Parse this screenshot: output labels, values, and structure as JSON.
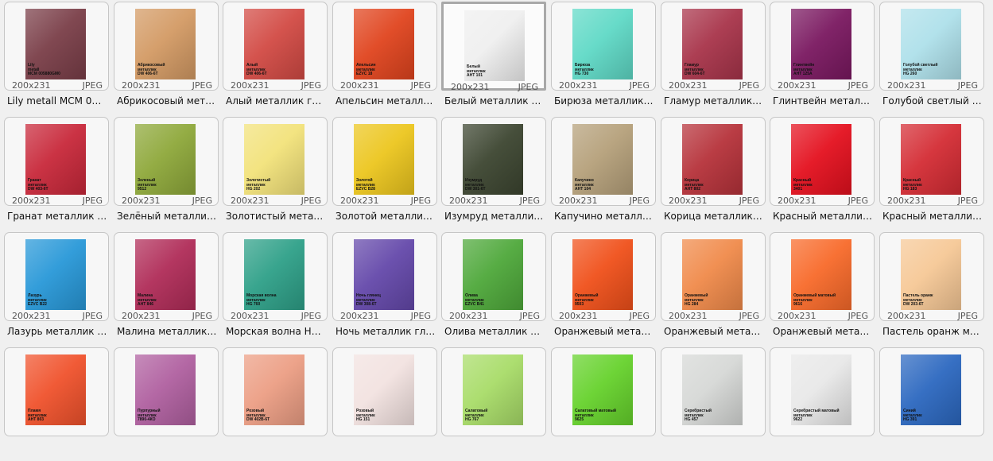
{
  "thumbnails": [
    {
      "caption": "Lily metall MCM 005...",
      "dims": "200x231",
      "format": "JPEG",
      "tag": [
        "Lily",
        "metall",
        "MCM 005880GM0"
      ],
      "color": "#7a3e48"
    },
    {
      "caption": "Абрикосовый метал...",
      "dims": "200x231",
      "format": "JPEG",
      "tag": [
        "Абрикосовый",
        "металлик",
        "DW 406-6T"
      ],
      "color": "#d39a64"
    },
    {
      "caption": "Алый металлик гля...",
      "dims": "200x231",
      "format": "JPEG",
      "tag": [
        "Алый",
        "металлик",
        "DW 406-6T"
      ],
      "color": "#d24a44"
    },
    {
      "caption": "Апельсин металлик...",
      "dims": "200x231",
      "format": "JPEG",
      "tag": [
        "Апельсин",
        "металлик",
        "EZVC 18"
      ],
      "color": "#e0441e"
    },
    {
      "caption": "Белый металлик А...",
      "dims": "200x231",
      "format": "JPEG",
      "tag": [
        "Белый",
        "металлик",
        "АНТ 101"
      ],
      "color": "#efefef",
      "selected": true
    },
    {
      "caption": "Бирюза металлик Н...",
      "dims": "200x231",
      "format": "JPEG",
      "tag": [
        "Бирюза",
        "металлик",
        "HG 730"
      ],
      "color": "#5fd9c6"
    },
    {
      "caption": "Гламур металлик г...",
      "dims": "200x231",
      "format": "JPEG",
      "tag": [
        "Гламур",
        "металлик",
        "DW 604-6T"
      ],
      "color": "#a8344a"
    },
    {
      "caption": "Глинтвейн металли...",
      "dims": "200x231",
      "format": "JPEG",
      "tag": [
        "Глинтвейн",
        "металлик",
        "АНТ 125А"
      ],
      "color": "#7a1860"
    },
    {
      "caption": "Голубой светлый м...",
      "dims": "200x231",
      "format": "JPEG",
      "tag": [
        "Голубой светлый",
        "металлик",
        "HG 260"
      ],
      "color": "#aee0ea"
    },
    {
      "caption": "Гранат металлик гл...",
      "dims": "200x231",
      "format": "JPEG",
      "tag": [
        "Гранат",
        "металлик",
        "DW 403-6T"
      ],
      "color": "#c8283a"
    },
    {
      "caption": "Зелёный металлик ...",
      "dims": "200x231",
      "format": "JPEG",
      "tag": [
        "Зеленый",
        "металлик",
        "9512"
      ],
      "color": "#8ea83a"
    },
    {
      "caption": "Золотистый металл...",
      "dims": "200x231",
      "format": "JPEG",
      "tag": [
        "Золотистый",
        "металлик",
        "HG 202"
      ],
      "color": "#f2e27a"
    },
    {
      "caption": "Золотой металлик ...",
      "dims": "200x231",
      "format": "JPEG",
      "tag": [
        "Золотой",
        "металлик",
        "EZVC B28"
      ],
      "color": "#ecc61e"
    },
    {
      "caption": "Изумруд металлик ...",
      "dims": "200x231",
      "format": "JPEG",
      "tag": [
        "Изумруд",
        "металлик",
        "DW 301-6T"
      ],
      "color": "#3c4530"
    },
    {
      "caption": "Капучино металлик...",
      "dims": "200x231",
      "format": "JPEG",
      "tag": [
        "Капучино",
        "металлик",
        "АНТ 104"
      ],
      "color": "#b5a07a"
    },
    {
      "caption": "Корица металлик А...",
      "dims": "200x231",
      "format": "JPEG",
      "tag": [
        "Корица",
        "металлик",
        "АНТ 802"
      ],
      "color": "#b6323a"
    },
    {
      "caption": "Красный металлик ...",
      "dims": "200x231",
      "format": "JPEG",
      "tag": [
        "Красный",
        "металлик",
        "3401"
      ],
      "color": "#e4101e"
    },
    {
      "caption": "Красный металлик ...",
      "dims": "200x231",
      "format": "JPEG",
      "tag": [
        "Красный",
        "металлик",
        "HG 183"
      ],
      "color": "#d42c34"
    },
    {
      "caption": "Лазурь металлик гл...",
      "dims": "200x231",
      "format": "JPEG",
      "tag": [
        "Лазурь",
        "металлик",
        "EZVC B22"
      ],
      "color": "#2898d8"
    },
    {
      "caption": "Малина металлик гл...",
      "dims": "200x231",
      "format": "JPEG",
      "tag": [
        "Малина",
        "металлик",
        "АНТ 846"
      ],
      "color": "#b02c58"
    },
    {
      "caption": "Морская волна HG ...",
      "dims": "200x231",
      "format": "JPEG",
      "tag": [
        "Морская волна",
        "металлик",
        "HG 760"
      ],
      "color": "#2ea088"
    },
    {
      "caption": "Ночь металлик гля...",
      "dims": "200x231",
      "format": "JPEG",
      "tag": [
        "Ночь глянец",
        "металлик",
        "DW 308-6T"
      ],
      "color": "#6448aa"
    },
    {
      "caption": "Олива металлик гл...",
      "dims": "200x231",
      "format": "JPEG",
      "tag": [
        "Олива",
        "металлик",
        "EZVC B41"
      ],
      "color": "#4ea83a"
    },
    {
      "caption": "Оранжевый металл...",
      "dims": "200x231",
      "format": "JPEG",
      "tag": [
        "Оранжевый",
        "металлик",
        "9503"
      ],
      "color": "#f0501a"
    },
    {
      "caption": "Оранжевый металл...",
      "dims": "200x231",
      "format": "JPEG",
      "tag": [
        "Оранжевый",
        "металлик",
        "HG 284"
      ],
      "color": "#f08a4a"
    },
    {
      "caption": "Оранжевый металл...",
      "dims": "200x231",
      "format": "JPEG",
      "tag": [
        "Оранжевый матовый",
        "металлик",
        "9616"
      ],
      "color": "#f86a2a"
    },
    {
      "caption": "Пастель оранж мет...",
      "dims": "200x231",
      "format": "JPEG",
      "tag": [
        "Пастель оранж",
        "металлик",
        "DW 203-6T"
      ],
      "color": "#f6c896"
    },
    {
      "caption": "",
      "dims": "",
      "format": "",
      "tag": [
        "Пламя",
        "металлик",
        "АНТ 803"
      ],
      "color": "#f0522c"
    },
    {
      "caption": "",
      "dims": "",
      "format": "",
      "tag": [
        "Пурпурный",
        "металлик",
        "7890-4КО"
      ],
      "color": "#b060a0"
    },
    {
      "caption": "",
      "dims": "",
      "format": "",
      "tag": [
        "Розовый",
        "металлик",
        "DW 402B-6T"
      ],
      "color": "#ec9e84"
    },
    {
      "caption": "",
      "dims": "",
      "format": "",
      "tag": [
        "Розовый",
        "металлик",
        "HG 151"
      ],
      "color": "#f2e2e0"
    },
    {
      "caption": "",
      "dims": "",
      "format": "",
      "tag": [
        "Салатовый",
        "металлик",
        "HG 767"
      ],
      "color": "#a8dc68"
    },
    {
      "caption": "",
      "dims": "",
      "format": "",
      "tag": [
        "Салатовый матовый",
        "металлик",
        "9625"
      ],
      "color": "#66d22c"
    },
    {
      "caption": "",
      "dims": "",
      "format": "",
      "tag": [
        "Серебристый",
        "металлик",
        "HG 457"
      ],
      "color": "#d6d8d6"
    },
    {
      "caption": "",
      "dims": "",
      "format": "",
      "tag": [
        "Серебристый матовый",
        "металлик",
        "9622"
      ],
      "color": "#e8e8e8"
    },
    {
      "caption": "",
      "dims": "",
      "format": "",
      "tag": [
        "Синий",
        "металлик",
        "HG 391"
      ],
      "color": "#2c68c0"
    }
  ]
}
